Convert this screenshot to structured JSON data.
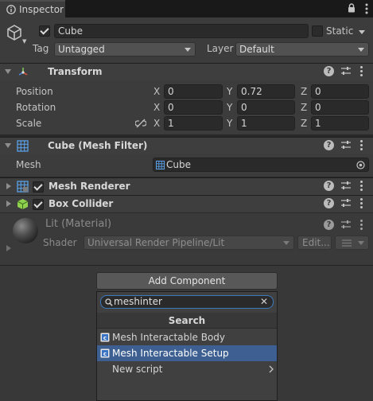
{
  "tab": {
    "title": "Inspector"
  },
  "gameobject": {
    "name": "Cube",
    "static_label": "Static",
    "tag_label": "Tag",
    "tag_value": "Untagged",
    "layer_label": "Layer",
    "layer_value": "Default"
  },
  "transform": {
    "title": "Transform",
    "rows": [
      {
        "label": "Position",
        "x": "0",
        "y": "0.72",
        "z": "0"
      },
      {
        "label": "Rotation",
        "x": "0",
        "y": "0",
        "z": "0"
      },
      {
        "label": "Scale",
        "x": "1",
        "y": "1",
        "z": "1"
      }
    ],
    "axes": {
      "x": "X",
      "y": "Y",
      "z": "Z"
    }
  },
  "mesh_filter": {
    "title": "Cube (Mesh Filter)",
    "mesh_label": "Mesh",
    "mesh_value": "Cube"
  },
  "mesh_renderer": {
    "title": "Mesh Renderer"
  },
  "box_collider": {
    "title": "Box Collider"
  },
  "material": {
    "title": "Lit (Material)",
    "shader_label": "Shader",
    "shader_value": "Universal Render Pipeline/Lit",
    "edit_label": "Edit..."
  },
  "add_component": {
    "button_label": "Add Component",
    "search_value": "meshinter",
    "section_title": "Search",
    "items": [
      {
        "label": "Mesh Interactable Body"
      },
      {
        "label": "Mesh Interactable Setup"
      },
      {
        "label": "New script"
      }
    ]
  },
  "colors": {
    "selection": "#3d5f91",
    "focus_border": "#3a79bb",
    "panel": "#3c3c3c"
  }
}
